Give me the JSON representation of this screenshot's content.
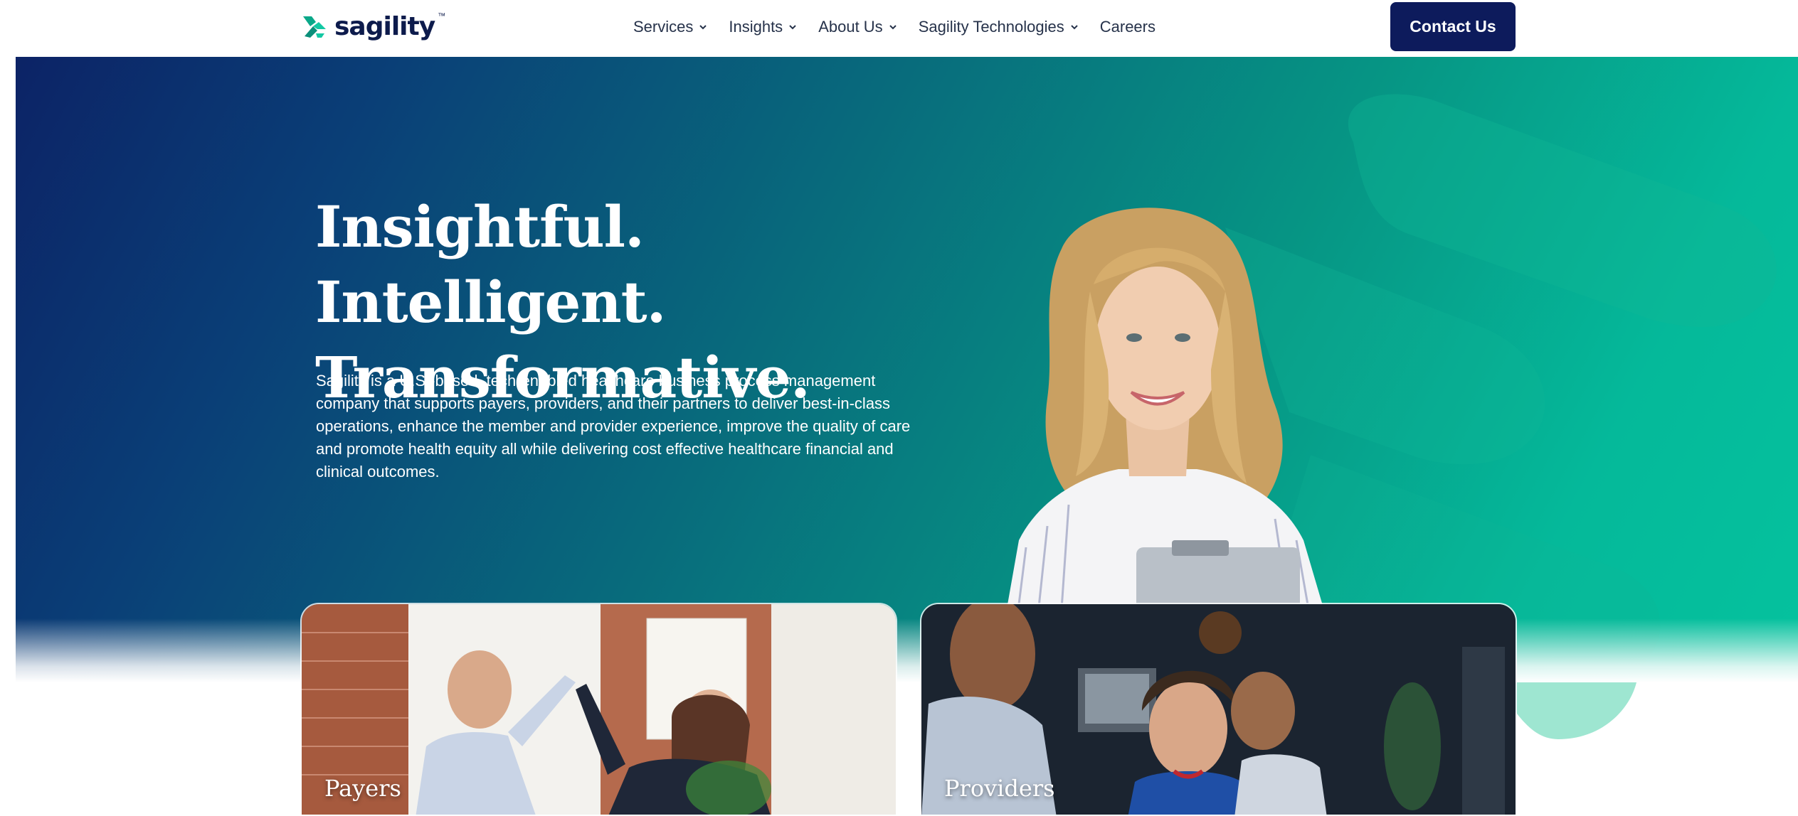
{
  "header": {
    "logo_text": "sagility",
    "logo_tm": "™",
    "nav": [
      {
        "label": "Services",
        "has_dropdown": true
      },
      {
        "label": "Insights",
        "has_dropdown": true
      },
      {
        "label": "About Us",
        "has_dropdown": true
      },
      {
        "label": "Sagility Technologies",
        "has_dropdown": true
      },
      {
        "label": "Careers",
        "has_dropdown": false
      }
    ],
    "contact_label": "Contact Us"
  },
  "hero": {
    "headline_line1": "Insightful. Intelligent.",
    "headline_line2": "Transformative.",
    "intro": "Sagility is a U.S.-based, tech-enabled healthcare business process management company that supports payers, providers, and their partners to deliver best-in-class operations, enhance the member and provider experience, improve the quality of care and promote health equity all while delivering cost effective healthcare financial and clinical outcomes."
  },
  "cards": [
    {
      "label": "Payers"
    },
    {
      "label": "Providers"
    }
  ],
  "colors": {
    "brand_navy": "#0d1b5c",
    "brand_teal": "#05c29e",
    "nav_text": "#26324a"
  },
  "icons": {
    "logo": "sagility-logo-mark",
    "dropdown": "chevron-down-icon"
  }
}
